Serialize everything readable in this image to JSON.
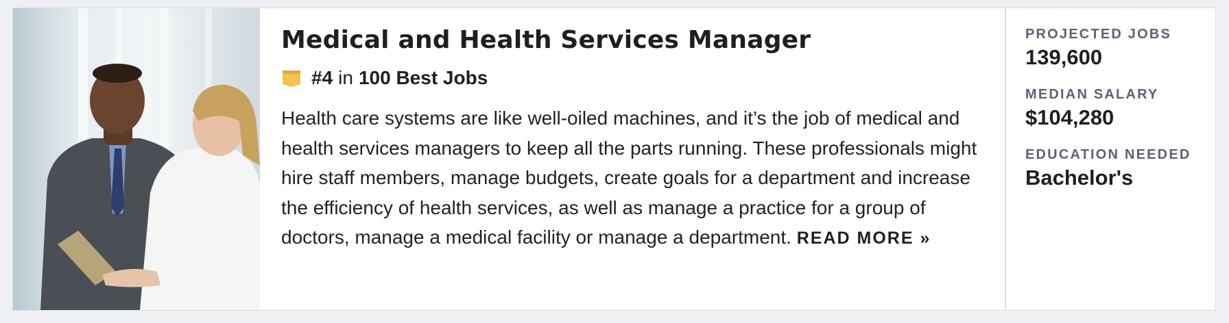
{
  "job": {
    "title": "Medical and Health Services Manager",
    "rank_number": "#4",
    "rank_in": "in",
    "rank_list": "100 Best Jobs",
    "description": "Health care systems are like well-oiled machines, and it’s the job of medical and health services managers to keep all the parts running. These professionals might hire staff members, manage budgets, create goals for a department and increase the efficiency of health services, as well as manage a practice for a group of doctors, manage a medical facility or manage a department.",
    "read_more_label": "READ MORE »"
  },
  "stats": {
    "projected_jobs_label": "PROJECTED JOBS",
    "projected_jobs_value": "139,600",
    "median_salary_label": "MEDIAN SALARY",
    "median_salary_value": "$104,280",
    "education_label": "EDUCATION NEEDED",
    "education_value": "Bachelor's"
  },
  "icons": {
    "rank_badge": "ribbon-badge-icon"
  },
  "colors": {
    "badge": "#f2c14e",
    "label": "#5b6273",
    "text": "#1f1f23"
  }
}
